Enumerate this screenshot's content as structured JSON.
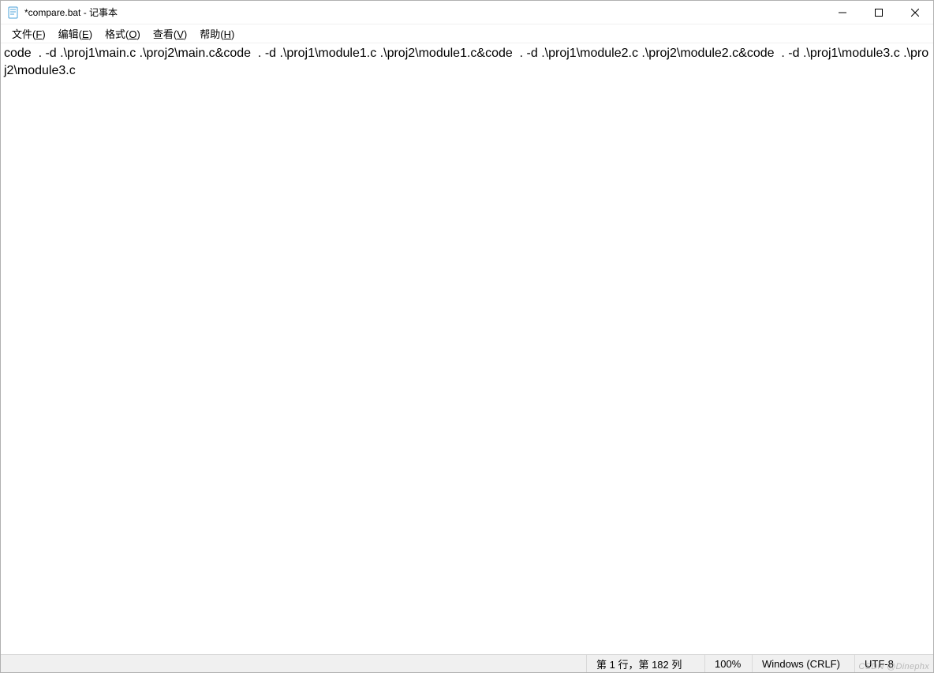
{
  "window": {
    "title": "*compare.bat - 记事本"
  },
  "menu": {
    "file": {
      "label": "文件",
      "key": "F"
    },
    "edit": {
      "label": "编辑",
      "key": "E"
    },
    "format": {
      "label": "格式",
      "key": "O"
    },
    "view": {
      "label": "查看",
      "key": "V"
    },
    "help": {
      "label": "帮助",
      "key": "H"
    }
  },
  "editor": {
    "content": "code  . -d .\\proj1\\main.c .\\proj2\\main.c&code  . -d .\\proj1\\module1.c .\\proj2\\module1.c&code  . -d .\\proj1\\module2.c .\\proj2\\module2.c&code  . -d .\\proj1\\module3.c .\\proj2\\module3.c"
  },
  "status": {
    "position": "第 1 行，第 182 列",
    "zoom": "100%",
    "line_ending": "Windows (CRLF)",
    "encoding": "UTF-8"
  },
  "watermark": "CSDN @Dinephx"
}
